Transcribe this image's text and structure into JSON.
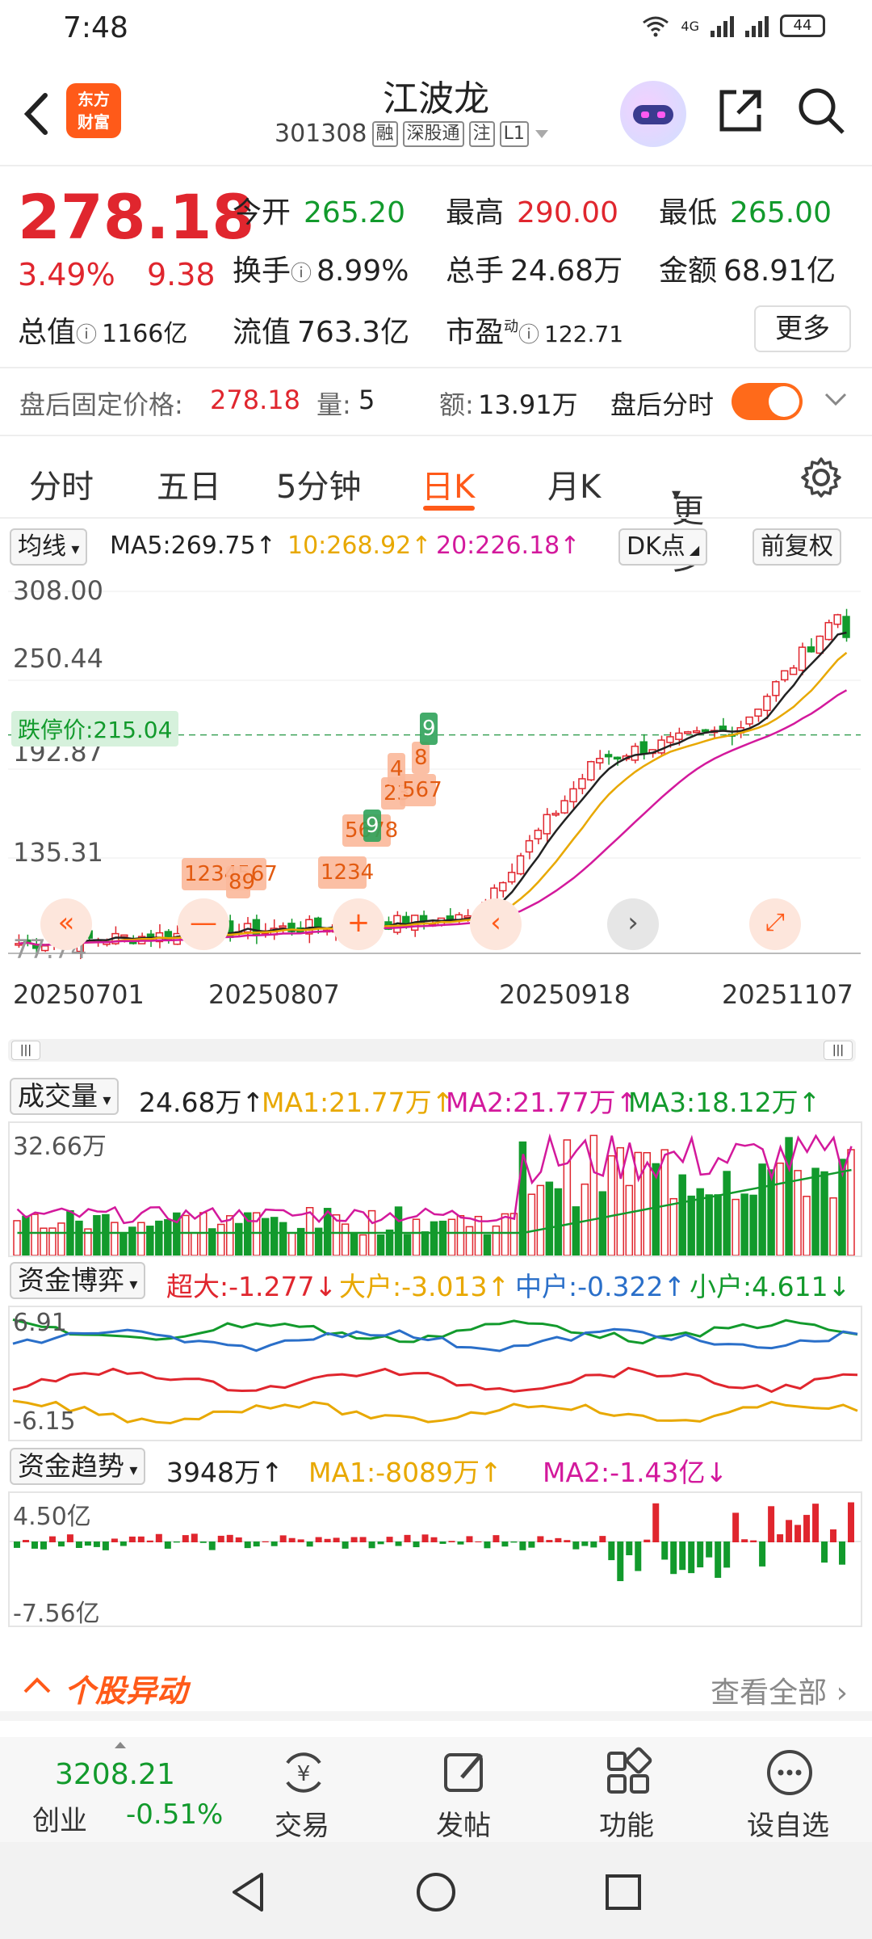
{
  "status": {
    "time": "7:48",
    "net": "4G",
    "battery": "44"
  },
  "nav": {
    "title": "江波龙",
    "code": "301308",
    "tags": [
      "融",
      "深股通",
      "注",
      "L1"
    ],
    "logo_line1": "东方",
    "logo_line2": "财富"
  },
  "quote": {
    "price": "278.18",
    "change_pct": "3.49%",
    "change": "9.38",
    "open_label": "今开",
    "open": "265.20",
    "high_label": "最高",
    "high": "290.00",
    "low_label": "最低",
    "low": "265.00",
    "turnover_label": "换手",
    "turnover": "8.99%",
    "volume_label": "总手",
    "volume": "24.68万",
    "amount_label": "金额",
    "amount": "68.91亿",
    "mktcap_label": "总值",
    "mktcap": "1166亿",
    "float_label": "流值",
    "float": "763.3亿",
    "pe_label": "市盈",
    "pe_sup": "动",
    "pe": "122.71",
    "more": "更多"
  },
  "after_hours": {
    "label": "盘后固定价格:",
    "price": "278.18",
    "qty_label": "量:",
    "qty": "5",
    "amt_label": "额:",
    "amt": "13.91万",
    "toggle_label": "盘后分时"
  },
  "tabs": [
    "分时",
    "五日",
    "5分钟",
    "日K",
    "月K",
    "更多"
  ],
  "ma": {
    "chip": "均线",
    "ma5": "MA5:269.75↑",
    "ma10": "10:268.92↑",
    "ma20": "20:226.18↑",
    "dk": "DK点",
    "fq": "前复权"
  },
  "kline": {
    "y_labels": [
      "308.00",
      "250.44",
      "192.87",
      "135.31",
      "77.74"
    ],
    "limit_down": "跌停价:215.04",
    "dates": [
      "20250701",
      "20250807",
      "20250918",
      "20251107"
    ],
    "markers": [
      "1234567",
      "89",
      "1234",
      "5678",
      "9",
      "23",
      "4",
      "567",
      "8",
      "9"
    ]
  },
  "chart_data": {
    "type": "candlestick",
    "ylim": [
      77.74,
      308.0
    ],
    "x": [
      "20250701",
      "20250807",
      "20250918",
      "20251107"
    ],
    "limit_down_price": 215.04,
    "last": {
      "close": 278.18,
      "open": 265.2,
      "high": 290.0,
      "low": 265.0
    },
    "ma": {
      "MA5": 269.75,
      "MA10": 268.92,
      "MA20": 226.18
    }
  },
  "volume": {
    "chip": "成交量",
    "value": "24.68万↑",
    "ma1": "MA1:21.77万↑",
    "ma2": "MA2:21.77万↑",
    "ma3": "MA3:18.12万↑",
    "y_label": "32.66万"
  },
  "fund_game": {
    "chip": "资金博弈",
    "super": "超大:-1.277↓",
    "large": "大户:-3.013↑",
    "mid": "中户:-0.322↑",
    "small": "小户:4.611↓",
    "y_top": "6.91",
    "y_bot": "-6.15"
  },
  "fund_trend": {
    "chip": "资金趋势",
    "value": "3948万↑",
    "ma1": "MA1:-8089万↑",
    "ma2": "MA2:-1.43亿↓",
    "y_top": "4.50亿",
    "y_bot": "-7.56亿"
  },
  "yidong": {
    "title": "个股异动",
    "all": "查看全部"
  },
  "bottom": {
    "index_value": "3208.21",
    "index_name": "创业",
    "index_chg": "-0.51%",
    "items": [
      "交易",
      "发帖",
      "功能",
      "设自选"
    ]
  },
  "colors": {
    "up": "#e0262e",
    "down": "#129a2c",
    "accent": "#ff5a19"
  }
}
